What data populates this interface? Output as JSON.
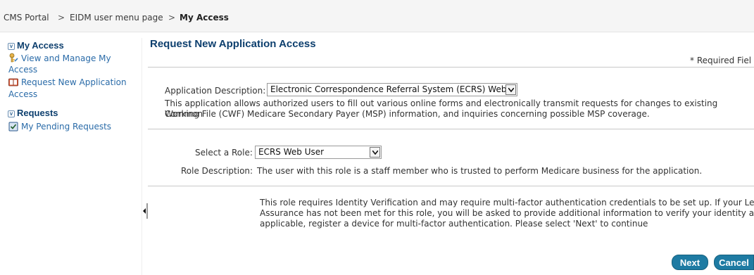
{
  "breadcrumb": {
    "items": [
      "CMS Portal",
      "EIDM user menu page",
      "My Access"
    ],
    "separator": ">"
  },
  "sidebar": {
    "sections": [
      {
        "title": "My Access",
        "items": [
          {
            "line1": "View and Manage My",
            "line2": "Access"
          },
          {
            "line1": "Request New Application",
            "line2": "Access"
          }
        ]
      },
      {
        "title": "Requests",
        "items": [
          {
            "line1": "My Pending Requests"
          }
        ]
      }
    ],
    "toggle_glyph": "v"
  },
  "main": {
    "title": "Request New Application Access",
    "required_note": "* Required Fiel",
    "application": {
      "label": "Application Description:",
      "selected": "Electronic Correspondence Referral System (ECRS) Web",
      "description_lines": [
        "This application allows authorized users to fill out various online forms and electronically transmit requests for changes to existing Common",
        "Working File (CWF) Medicare Secondary Payer (MSP) information, and inquiries concerning possible MSP coverage."
      ]
    },
    "role": {
      "label": "Select a Role:",
      "selected": "ECRS Web User",
      "description_label": "Role Description:",
      "description": "The user with this role is a staff member who is trusted to perform Medicare business for the application."
    },
    "identity_notice_lines": [
      "This role requires Identity Verification and may require multi-factor authentication credentials to be set up. If your Level o",
      "Assurance has not been met for this role, you will be asked to provide additional information to verify your identity and if",
      "applicable, register a device for multi-factor authentication. Please select 'Next' to continue"
    ],
    "buttons": {
      "next": "Next",
      "cancel": "Cancel"
    }
  },
  "colors": {
    "heading": "#0d3f6e",
    "link": "#2a6ba8",
    "button": "#1e7ba3",
    "breadcrumb_bg": "#f5f5f5"
  }
}
